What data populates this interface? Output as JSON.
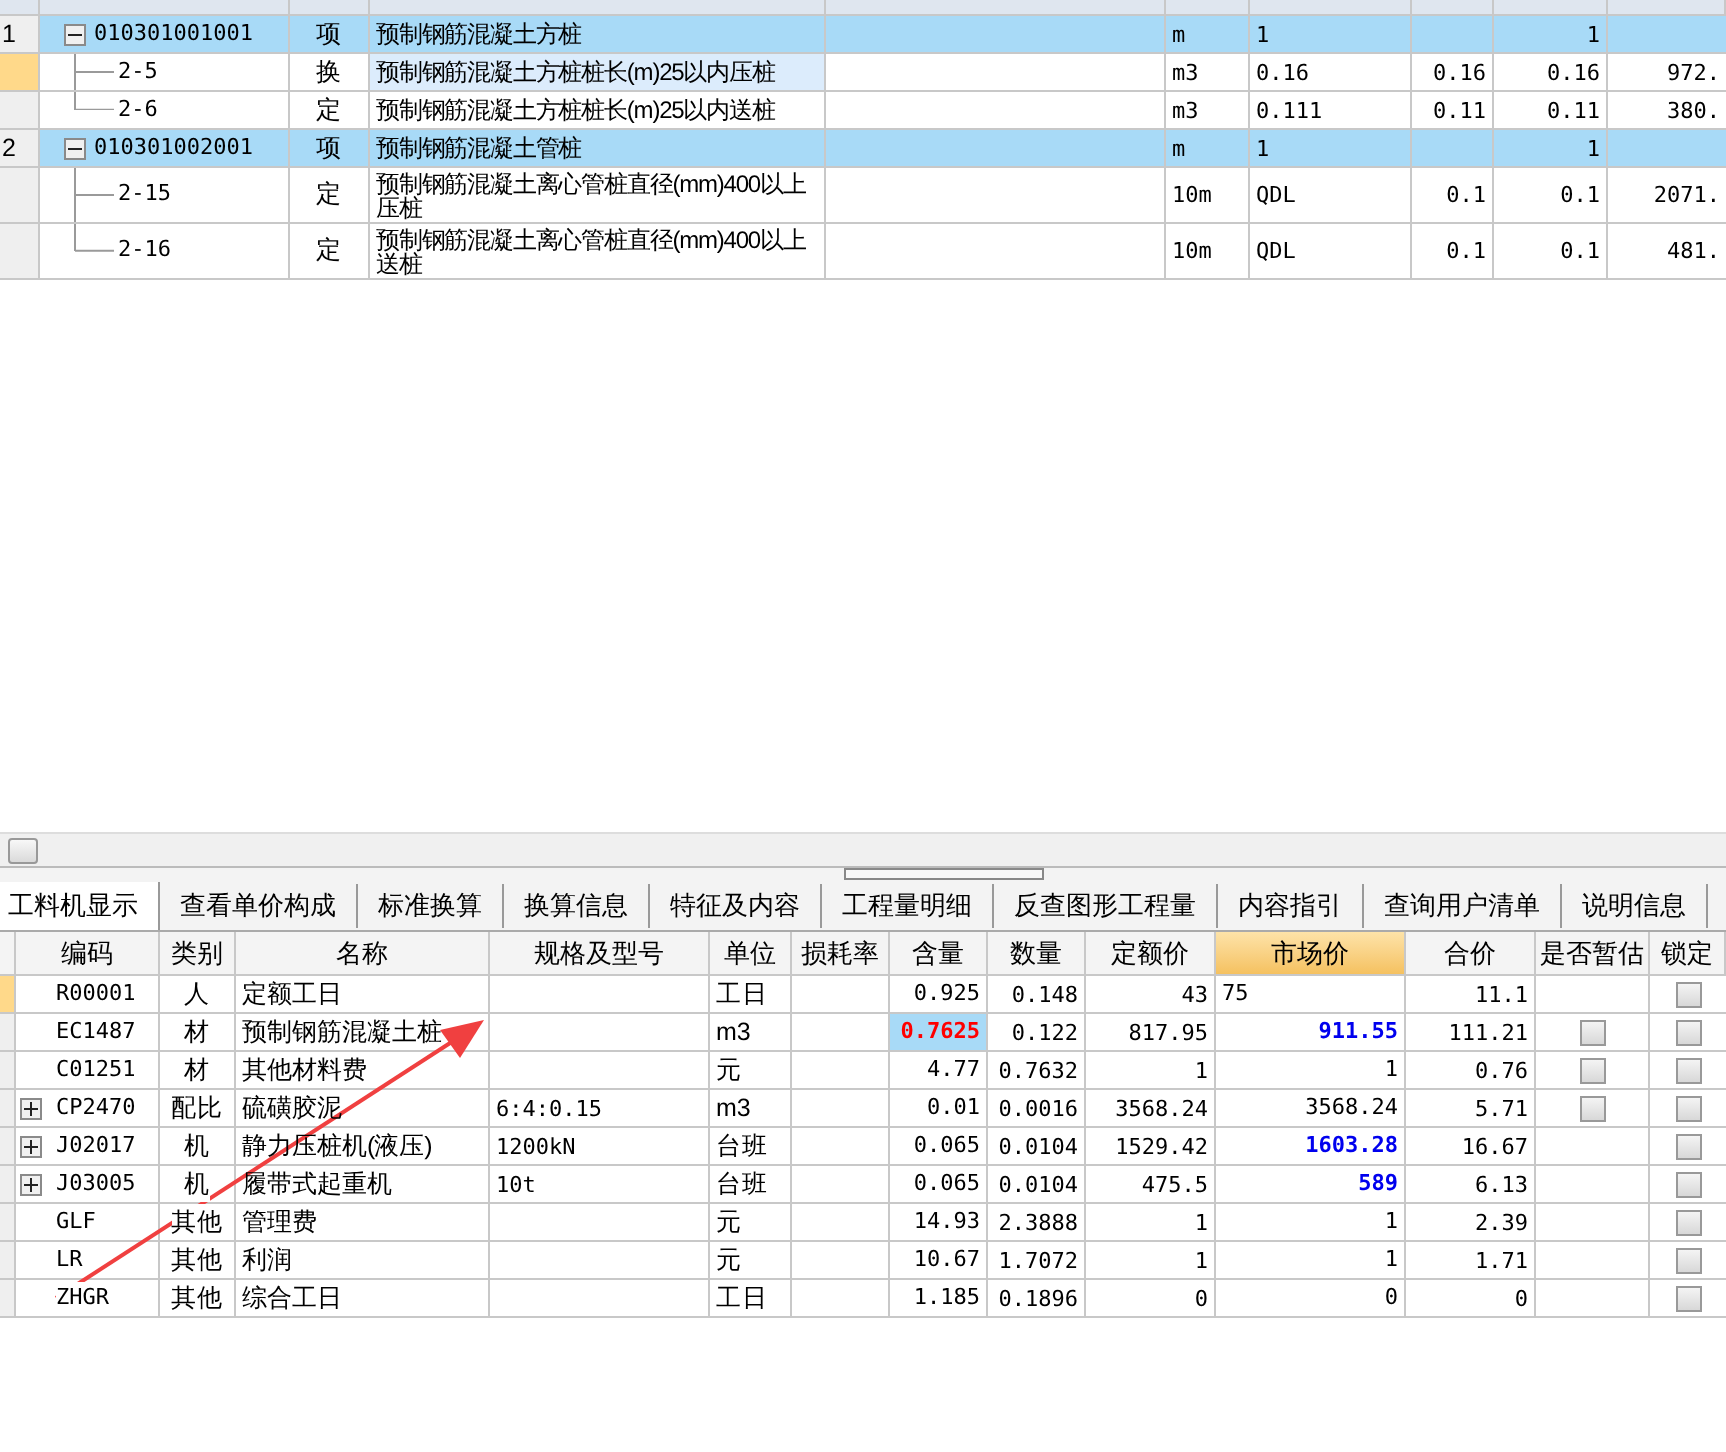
{
  "upper_grid": {
    "rows": [
      {
        "row_number": "1",
        "code": "010301001001",
        "expanded": true,
        "selected": false,
        "type": "项",
        "name": "预制钢筋混凝土方桩",
        "unit": "m",
        "expression": "1",
        "column_8": "1",
        "children": [
          {
            "code": "2-5",
            "selected": true,
            "type": "换",
            "name": "预制钢筋混凝土方桩桩长(m)25以内压桩",
            "unit": "m3",
            "expression": "0.16",
            "column_7": "0.16",
            "column_8": "0.16",
            "column_9": "972."
          },
          {
            "code": "2-6",
            "selected": false,
            "type": "定",
            "name": "预制钢筋混凝土方桩桩长(m)25以内送桩",
            "unit": "m3",
            "expression": "0.111",
            "column_7": "0.11",
            "column_8": "0.11",
            "column_9": "380."
          }
        ]
      },
      {
        "row_number": "2",
        "code": "010301002001",
        "expanded": true,
        "selected": false,
        "type": "项",
        "name": "预制钢筋混凝土管桩",
        "unit": "m",
        "expression": "1",
        "column_8": "1",
        "children": [
          {
            "code": "2-15",
            "selected": false,
            "type": "定",
            "name": "预制钢筋混凝土离心管桩直径(mm)400以上压桩",
            "unit": "10m",
            "expression": "QDL",
            "column_7": "0.1",
            "column_8": "0.1",
            "column_9": "2071."
          },
          {
            "code": "2-16",
            "selected": false,
            "type": "定",
            "name": "预制钢筋混凝土离心管桩直径(mm)400以上送桩",
            "unit": "10m",
            "expression": "QDL",
            "column_7": "0.1",
            "column_8": "0.1",
            "column_9": "481."
          }
        ]
      }
    ]
  },
  "tabs": [
    {
      "label": "工料机显示",
      "selected": true
    },
    {
      "label": "查看单价构成",
      "selected": false
    },
    {
      "label": "标准换算",
      "selected": false
    },
    {
      "label": "换算信息",
      "selected": false
    },
    {
      "label": "特征及内容",
      "selected": false
    },
    {
      "label": "工程量明细",
      "selected": false
    },
    {
      "label": "反查图形工程量",
      "selected": false
    },
    {
      "label": "内容指引",
      "selected": false
    },
    {
      "label": "查询用户清单",
      "selected": false
    },
    {
      "label": "说明信息",
      "selected": false
    }
  ],
  "resource_table": {
    "columns": [
      {
        "label": "编码",
        "selected": false
      },
      {
        "label": "类别",
        "selected": false
      },
      {
        "label": "名称",
        "selected": false
      },
      {
        "label": "规格及型号",
        "selected": false
      },
      {
        "label": "单位",
        "selected": false
      },
      {
        "label": "损耗率",
        "selected": false
      },
      {
        "label": "含量",
        "selected": false
      },
      {
        "label": "数量",
        "selected": false
      },
      {
        "label": "定额价",
        "selected": false
      },
      {
        "label": "市场价",
        "selected": true
      },
      {
        "label": "合价",
        "selected": false
      },
      {
        "label": "是否暂估",
        "selected": false
      },
      {
        "label": "锁定",
        "selected": false
      }
    ],
    "rows": [
      {
        "selected": true,
        "kind": "plain",
        "code": "R00001",
        "type": "人",
        "name": "定额工日",
        "spec": "",
        "unit": "工日",
        "content": "0.925",
        "content_selected": false,
        "quantity": "0.148",
        "quota_price": "43",
        "market_price": "75",
        "editing": true,
        "adjusted": false,
        "total": "11.1",
        "locked": false
      },
      {
        "selected": false,
        "kind": "plain",
        "code": "EC1487",
        "type": "材",
        "name": "预制钢筋混凝土桩",
        "spec": "",
        "unit": "m3",
        "content": "0.7625",
        "content_selected": true,
        "quantity": "0.122",
        "quota_price": "817.95",
        "market_price": "911.55",
        "editing": false,
        "adjusted": true,
        "total": "111.21",
        "provisional": false,
        "locked": false
      },
      {
        "selected": false,
        "kind": "plain",
        "code": "C01251",
        "type": "材",
        "name": "其他材料费",
        "spec": "",
        "unit": "元",
        "content": "4.77",
        "content_selected": false,
        "quantity": "0.7632",
        "quota_price": "1",
        "market_price": "1",
        "editing": false,
        "adjusted": false,
        "total": "0.76",
        "provisional": false,
        "locked": false
      },
      {
        "selected": false,
        "kind": "group",
        "expanded": false,
        "code": "CP2470",
        "type": "配比",
        "name": "硫磺胶泥",
        "spec": "6:4:0.15",
        "unit": "m3",
        "content": "0.01",
        "content_selected": false,
        "quantity": "0.0016",
        "quota_price": "3568.24",
        "market_price": "3568.24",
        "editing": false,
        "adjusted": false,
        "total": "5.71",
        "provisional": false,
        "locked": false
      },
      {
        "selected": false,
        "kind": "group",
        "expanded": false,
        "code": "J02017",
        "type": "机",
        "name": "静力压桩机(液压)",
        "spec": "1200kN",
        "unit": "台班",
        "content": "0.065",
        "content_selected": false,
        "quantity": "0.0104",
        "quota_price": "1529.42",
        "market_price": "1603.28",
        "editing": false,
        "adjusted": true,
        "total": "16.67",
        "locked": false
      },
      {
        "selected": false,
        "kind": "group",
        "expanded": false,
        "code": "J03005",
        "type": "机",
        "name": "履带式起重机",
        "spec": "10t",
        "unit": "台班",
        "content": "0.065",
        "content_selected": false,
        "quantity": "0.0104",
        "quota_price": "475.5",
        "market_price": "589",
        "editing": false,
        "adjusted": true,
        "total": "6.13",
        "locked": false
      },
      {
        "selected": false,
        "kind": "plain",
        "code": "GLF",
        "type": "其他",
        "name": "管理费",
        "spec": "",
        "unit": "元",
        "content": "14.93",
        "content_selected": false,
        "quantity": "2.3888",
        "quota_price": "1",
        "market_price": "1",
        "editing": false,
        "adjusted": false,
        "total": "2.39",
        "locked": false
      },
      {
        "selected": false,
        "kind": "plain",
        "code": "LR",
        "type": "其他",
        "name": "利润",
        "spec": "",
        "unit": "元",
        "content": "10.67",
        "content_selected": false,
        "quantity": "1.7072",
        "quota_price": "1",
        "market_price": "1",
        "editing": false,
        "adjusted": false,
        "total": "1.71",
        "locked": false
      },
      {
        "selected": false,
        "kind": "plain",
        "code": "ZHGR",
        "type": "其他",
        "name": "综合工日",
        "spec": "",
        "unit": "工日",
        "content": "1.185",
        "content_selected": false,
        "quantity": "0.1896",
        "quota_price": "0",
        "market_price": "0",
        "editing": false,
        "adjusted": false,
        "total": "0",
        "locked": false
      }
    ]
  }
}
